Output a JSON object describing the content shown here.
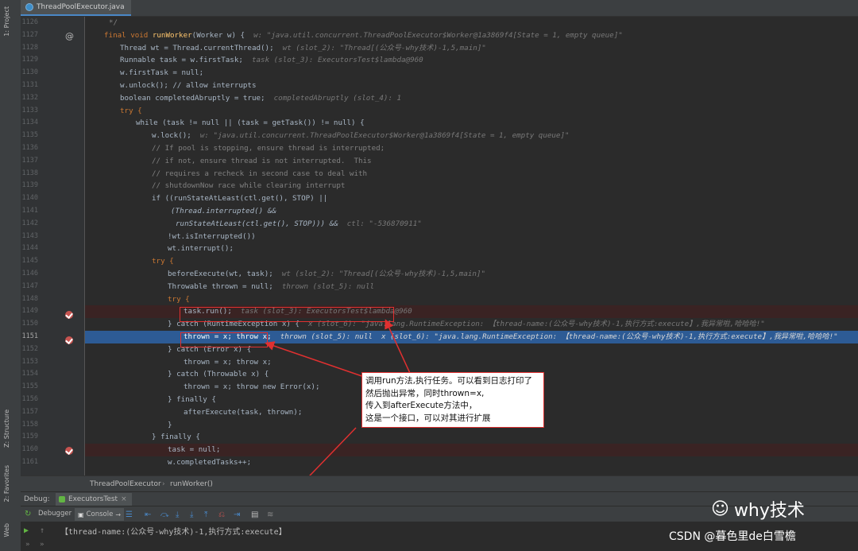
{
  "file_tab": "ThreadPoolExecutor.java",
  "sidebar": {
    "project": "1: Project",
    "structure": "Z: Structure",
    "favorites": "2: Favorites",
    "web": "Web"
  },
  "gutter_lines": [
    "1126",
    "1127",
    "1128",
    "1129",
    "1130",
    "1131",
    "1132",
    "1133",
    "1134",
    "1135",
    "1136",
    "1137",
    "1138",
    "1139",
    "1140",
    "1141",
    "1142",
    "1143",
    "1144",
    "1145",
    "1146",
    "1147",
    "1148",
    "1149",
    "1150",
    "1151",
    "1152",
    "1153",
    "1154",
    "1155",
    "1156",
    "1157",
    "1158",
    "1159",
    "1160",
    "1161"
  ],
  "code": {
    "l1126": "*/",
    "l1127_a": "final void ",
    "l1127_b": "runWorker",
    "l1127_c": "(Worker w) {",
    "l1127_hint": "w: \"java.util.concurrent.ThreadPoolExecutor$Worker@1a3869f4[State = 1, empty queue]\"",
    "l1128": "Thread wt = Thread.currentThread();",
    "l1128_hint": "wt (slot_2): \"Thread[(公众号-why技术)-1,5,main]\"",
    "l1129": "Runnable task = w.firstTask;",
    "l1129_hint": "task (slot_3): ExecutorsTest$lambda@960",
    "l1130": "w.firstTask = null;",
    "l1131": "w.unlock(); // allow interrupts",
    "l1132": "boolean completedAbruptly = true;",
    "l1132_hint": "completedAbruptly (slot_4): 1",
    "l1133": "try {",
    "l1134": "while (task != null || (task = getTask()) != null) {",
    "l1135": "w.lock();",
    "l1135_hint": "w: \"java.util.concurrent.ThreadPoolExecutor$Worker@1a3869f4[State = 1, empty queue]\"",
    "l1136": "// If pool is stopping, ensure thread is interrupted;",
    "l1137": "// if not, ensure thread is not interrupted.  This",
    "l1138": "// requires a recheck in second case to deal with",
    "l1139": "// shutdownNow race while clearing interrupt",
    "l1140": "if ((runStateAtLeast(ctl.get(), STOP) ||",
    "l1141": "(Thread.interrupted() &&",
    "l1142": "runStateAtLeast(ctl.get(), STOP))) &&",
    "l1142_hint": "ctl: \"-536870911\"",
    "l1143": "!wt.isInterrupted())",
    "l1144": "wt.interrupt();",
    "l1145": "try {",
    "l1146": "beforeExecute(wt, task);",
    "l1146_hint": "wt (slot_2): \"Thread[(公众号-why技术)-1,5,main]\"",
    "l1147": "Throwable thrown = null;",
    "l1147_hint": "thrown (slot_5): null",
    "l1148": "try {",
    "l1149": "task.run();",
    "l1149_hint": "task (slot_3): ExecutorsTest$lambda@960",
    "l1150": "} catch (RuntimeException x) {",
    "l1150_hint": "x (slot_6): \"java.lang.RuntimeException: 【thread-name:(公众号-why技术)-1,执行方式:execute】,我异常啦,哈哈哈!\"",
    "l1151": "thrown = x; throw x;",
    "l1151_hint": "thrown (slot_5): null  x (slot_6): \"java.lang.RuntimeException: 【thread-name:(公众号-why技术)-1,执行方式:execute】,我异常啦,哈哈哈!\"",
    "l1152": "} catch (Error x) {",
    "l1153": "thrown = x; throw x;",
    "l1154": "} catch (Throwable x) {",
    "l1155": "thrown = x; throw new Error(x);",
    "l1156": "} finally {",
    "l1157": "afterExecute(task, thrown);",
    "l1158": "}",
    "l1159": "} finally {",
    "l1160": "task = null;",
    "l1161": "w.completedTasks++;"
  },
  "callout_text": "调用run方法,执行任务。可以看到日志打印了\n然后抛出异常，同时thrown=x,\n传入到afterExecute方法中，\n这是一个接口，可以对其进行扩展",
  "breadcrumb": {
    "class": "ThreadPoolExecutor",
    "method": "runWorker()"
  },
  "debug": {
    "label": "Debug:",
    "config": "ExecutorsTest"
  },
  "toolbar": {
    "debugger": "Debugger",
    "console": "Console"
  },
  "console_output": "【thread-name:(公众号-why技术)-1,执行方式:execute】",
  "watermark": {
    "brand": "why技术",
    "csdn": "CSDN @暮色里de白雪檐"
  }
}
